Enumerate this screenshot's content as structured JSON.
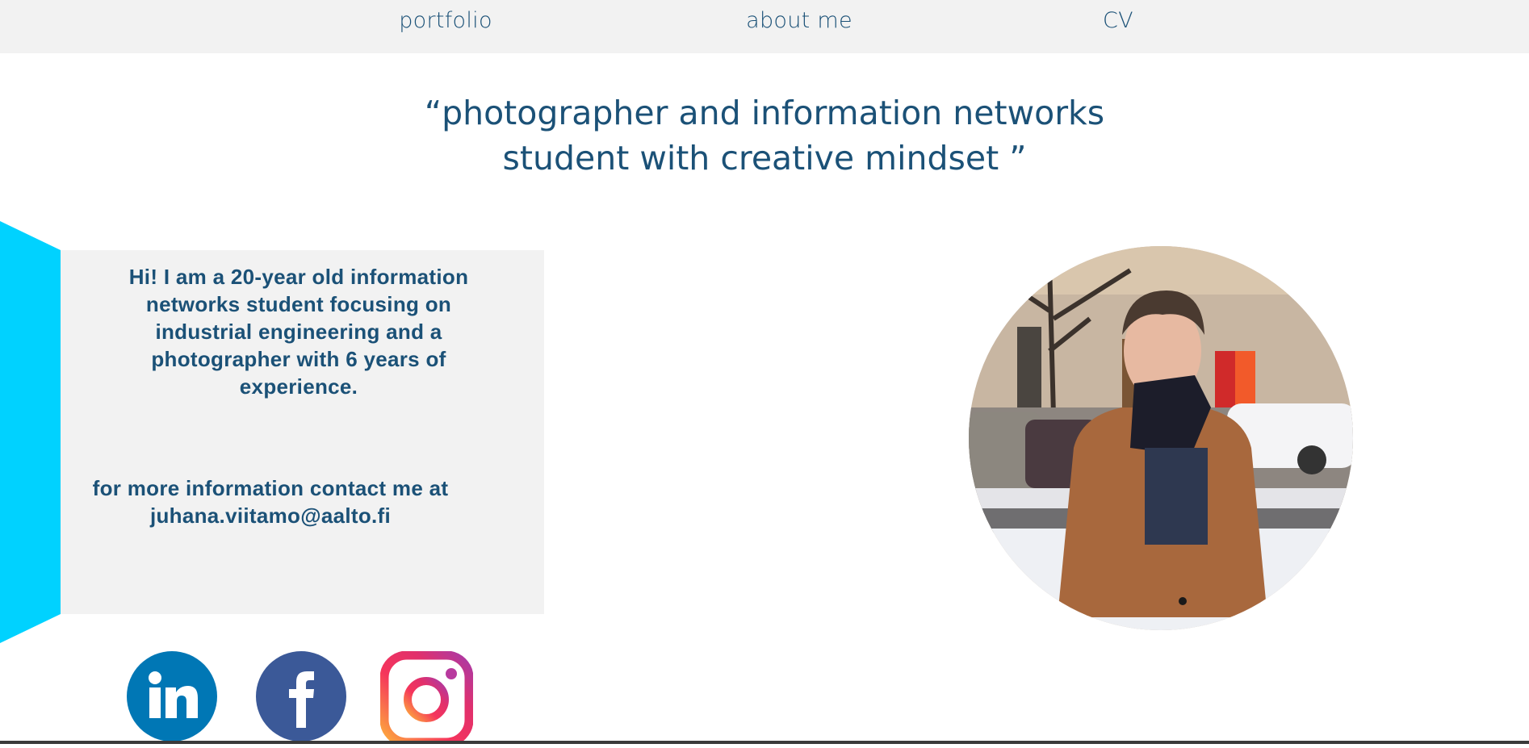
{
  "nav": {
    "items": [
      {
        "label": "portfolio"
      },
      {
        "label": "about me"
      },
      {
        "label": "CV"
      }
    ]
  },
  "headline": {
    "line1": "“photographer and information networks",
    "line2": "student with creative mindset ”"
  },
  "intro": {
    "text": "Hi! I am a 20-year old information networks student focusing on industrial engineering and a photographer with 6 years of experience.",
    "contact_line": "for more information contact me at",
    "email": "juhana.viitamo@aalto.fi"
  },
  "social": [
    {
      "name": "LinkedIn",
      "icon": "linkedin-icon",
      "color": "#0077b5"
    },
    {
      "name": "Facebook",
      "icon": "facebook-icon",
      "color": "#3b5998"
    },
    {
      "name": "Instagram",
      "icon": "instagram-icon",
      "color": "#e1306c"
    }
  ],
  "colors": {
    "accent": "#00d2ff",
    "text": "#1b5177",
    "panel": "#f2f2f2"
  }
}
